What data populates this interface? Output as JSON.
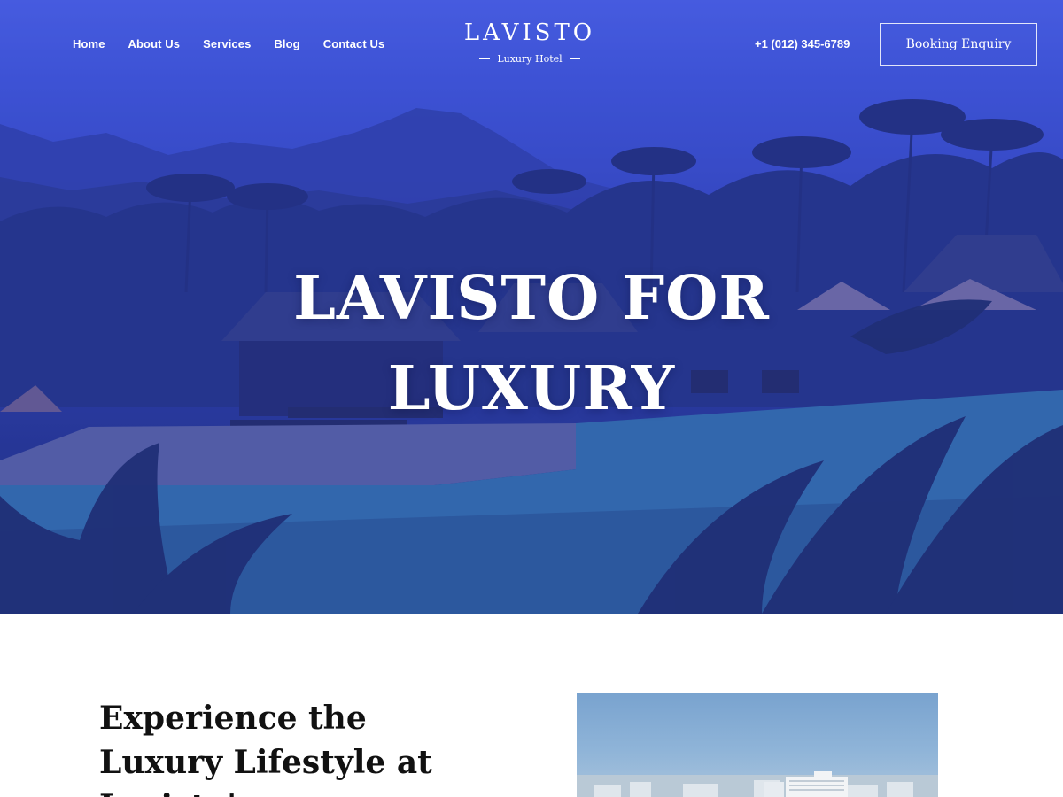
{
  "nav": {
    "links": [
      {
        "label": "Home"
      },
      {
        "label": "About Us"
      },
      {
        "label": "Services"
      },
      {
        "label": "Blog"
      },
      {
        "label": "Contact Us"
      }
    ],
    "logo": {
      "name": "LAVISTO",
      "tagline": "Luxury Hotel"
    },
    "phone": "+1 (012) 345-6789",
    "booking_label": "Booking Enquiry"
  },
  "hero": {
    "title_line1": "LAVISTO FOR",
    "title_line2": "LUXURY",
    "overlay_color": "#3d52d0"
  },
  "intro": {
    "heading": "Experience the Luxury Lifestyle at Lavisto's"
  },
  "colors": {
    "text_dark": "#111111",
    "white": "#ffffff"
  }
}
